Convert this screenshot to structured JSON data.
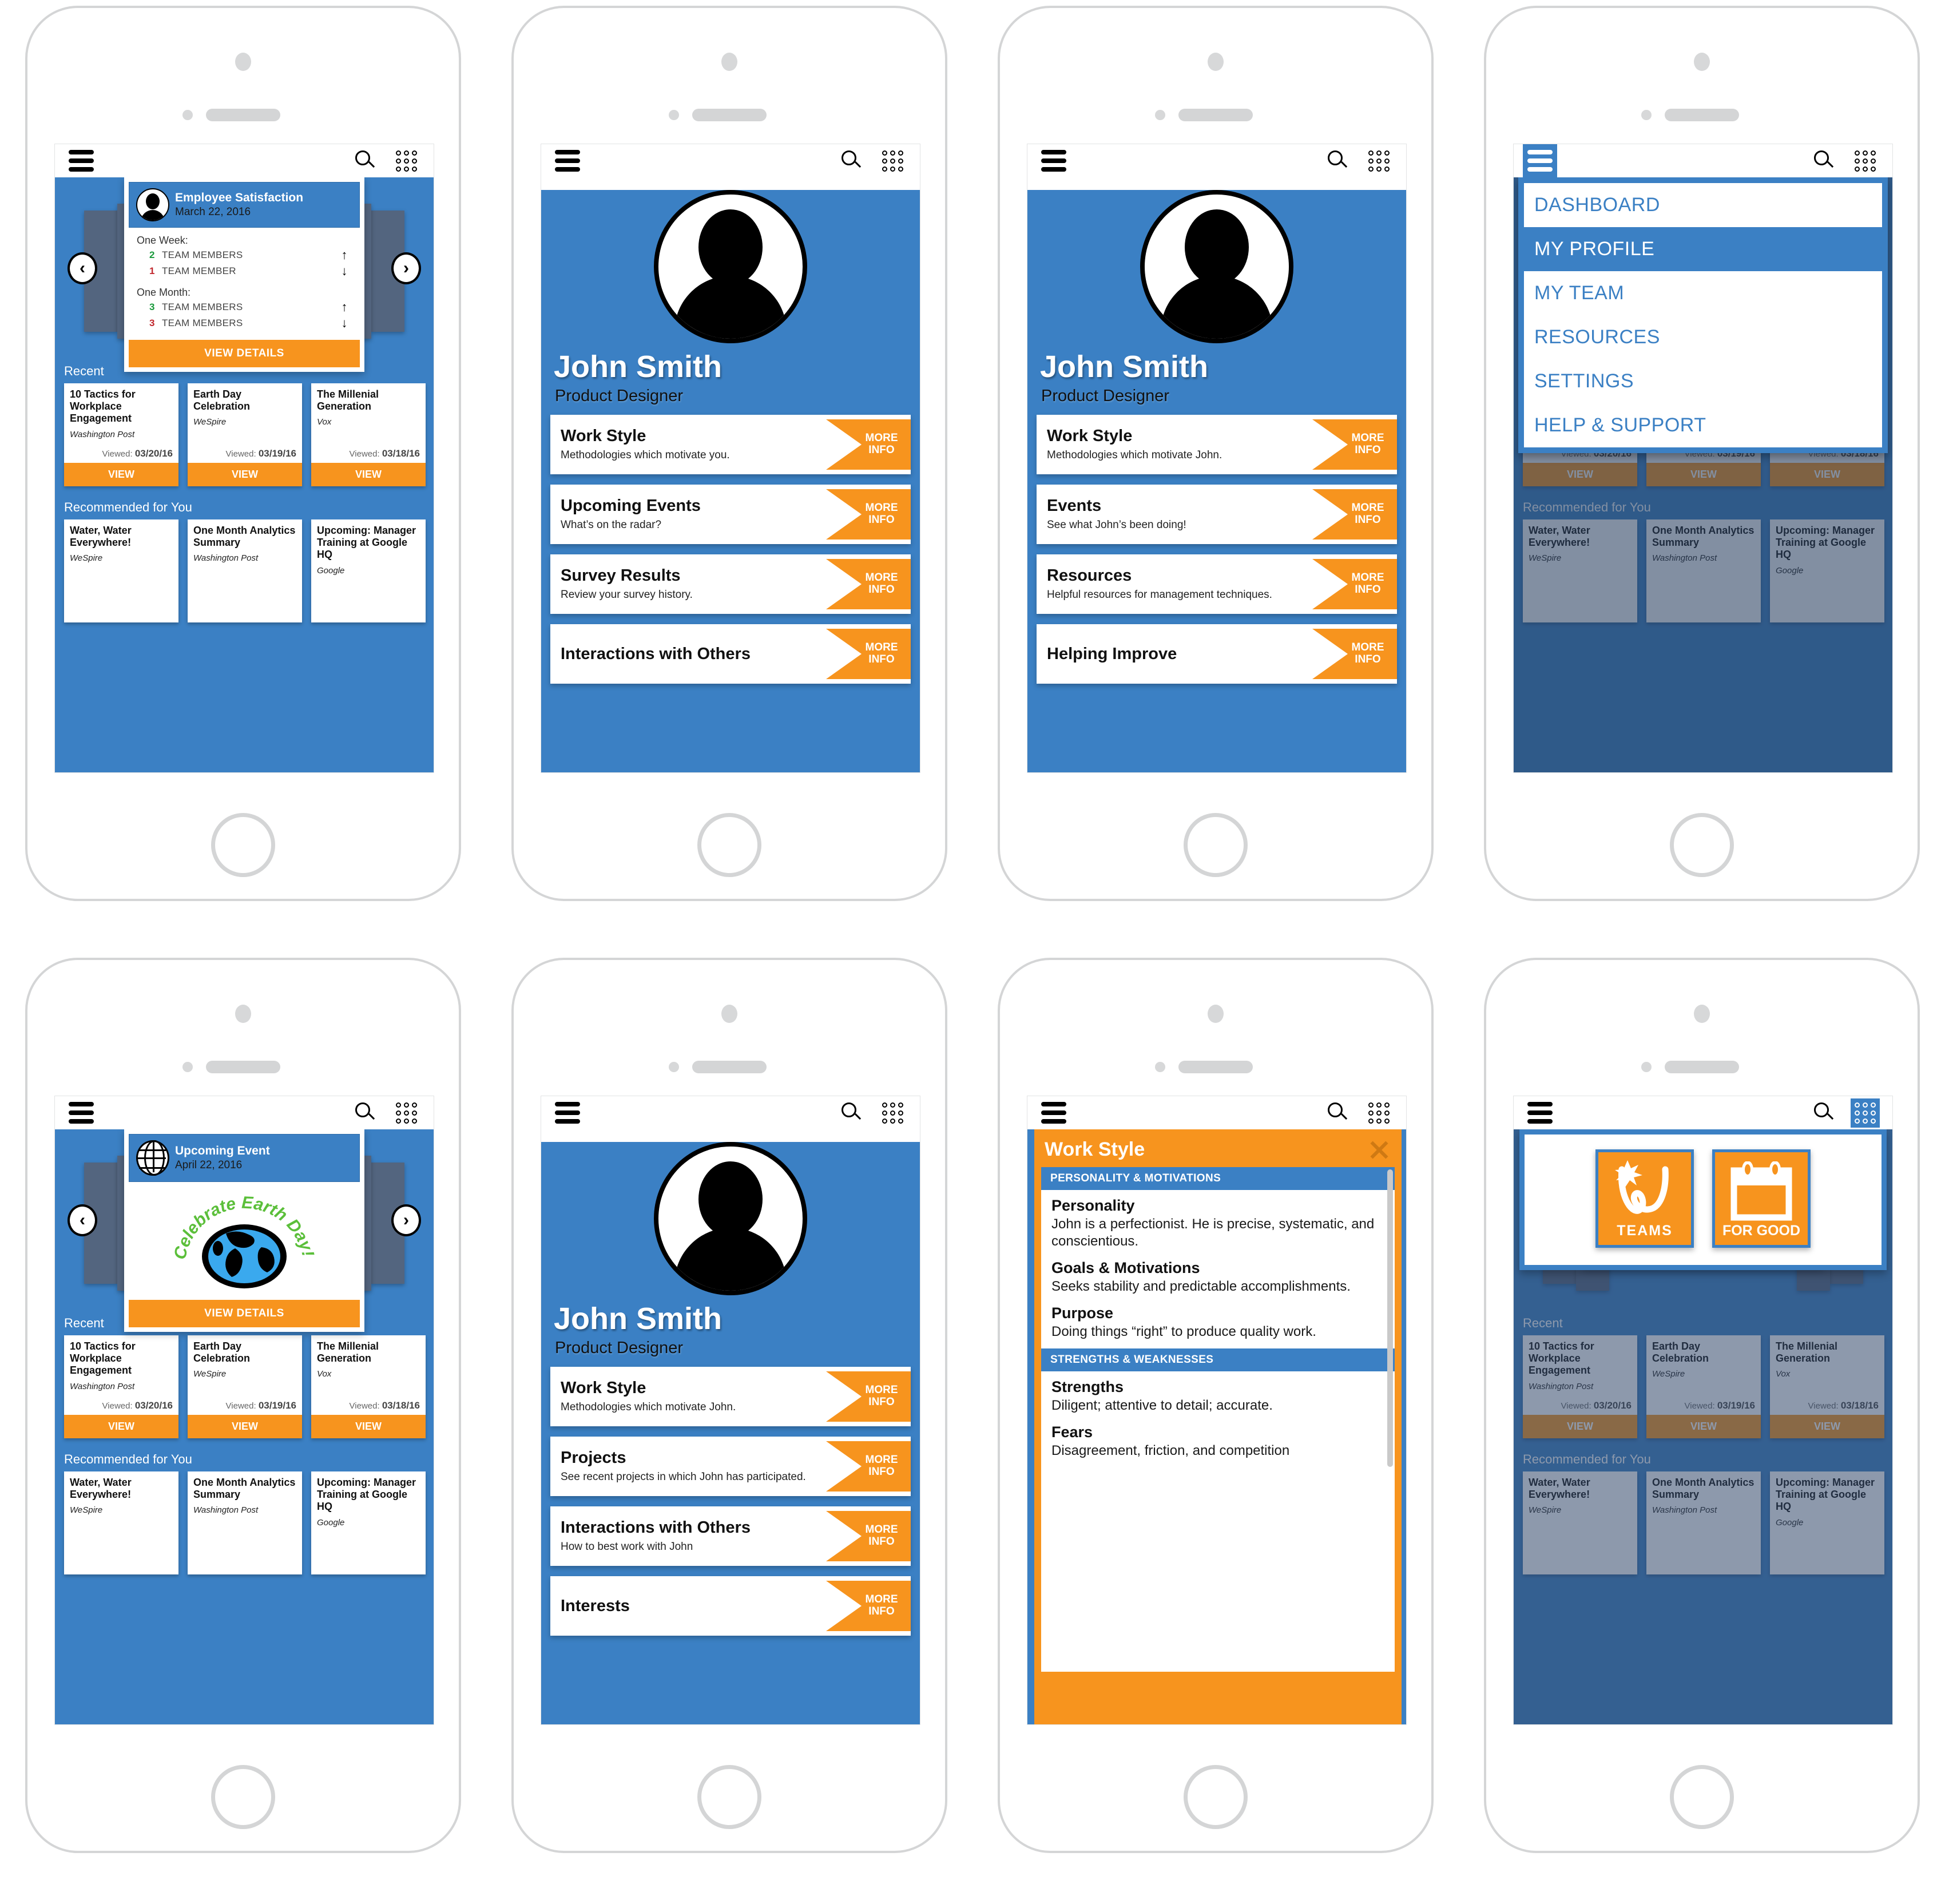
{
  "colors": {
    "blue": "#3b80c4",
    "orange": "#f7941e",
    "green": "#1a9a3c",
    "red": "#c1272d",
    "dark_slate": "#53657f"
  },
  "appbar": {
    "menu_icon": "hamburger-icon",
    "search_icon": "search-icon",
    "apps_icon": "grid-apps-icon"
  },
  "dashboard": {
    "carousel_prev": "‹",
    "carousel_next": "›",
    "satisfaction_card": {
      "avatar_icon": "person-avatar-icon",
      "title": "Employee Satisfaction",
      "date": "March 22, 2016",
      "week_label": "One Week:",
      "week_rows": [
        {
          "count": "2",
          "label": "TEAM MEMBERS",
          "arrow": "↑",
          "dir": "up"
        },
        {
          "count": "1",
          "label": "TEAM MEMBER",
          "arrow": "↓",
          "dir": "down"
        }
      ],
      "month_label": "One Month:",
      "month_rows": [
        {
          "count": "3",
          "label": "TEAM MEMBERS",
          "arrow": "↑",
          "dir": "up"
        },
        {
          "count": "3",
          "label": "TEAM MEMBERS",
          "arrow": "↓",
          "dir": "down"
        }
      ],
      "cta": "VIEW DETAILS"
    },
    "event_card": {
      "globe_icon": "globe-icon",
      "title": "Upcoming Event",
      "date": "April 22, 2016",
      "graphic_text": "Celebrate Earth Day!",
      "cta": "VIEW DETAILS"
    },
    "recent_heading": "Recent",
    "recent": [
      {
        "title": "10 Tactics for Workplace Engagement",
        "source": "Washington Post",
        "viewed_label": "Viewed:",
        "viewed": "03/20/16",
        "btn": "VIEW"
      },
      {
        "title": "Earth Day Celebration",
        "source": "WeSpire",
        "viewed_label": "Viewed:",
        "viewed": "03/19/16",
        "btn": "VIEW"
      },
      {
        "title": "The Millenial Generation",
        "source": "Vox",
        "viewed_label": "Viewed:",
        "viewed": "03/18/16",
        "btn": "VIEW"
      }
    ],
    "recommended_heading": "Recommended for You",
    "recommended": [
      {
        "title": "Water, Water Everywhere!",
        "source": "WeSpire"
      },
      {
        "title": "One Month Analytics Summary",
        "source": "Washington Post"
      },
      {
        "title": "Upcoming: Manager Training at Google HQ",
        "source": "Google"
      }
    ]
  },
  "profile": {
    "avatar_icon": "person-avatar-icon",
    "name": "John Smith",
    "role": "Product Designer",
    "more_info": "MORE INFO",
    "self_items": [
      {
        "title": "Work Style",
        "sub": "Methodologies which motivate you."
      },
      {
        "title": "Upcoming Events",
        "sub": "What’s on the radar?"
      },
      {
        "title": "Survey Results",
        "sub": "Review your survey history."
      },
      {
        "title": "Interactions with Others",
        "sub": ""
      }
    ],
    "manager_items": [
      {
        "title": "Work Style",
        "sub": "Methodologies which motivate John."
      },
      {
        "title": "Events",
        "sub": "See what John’s been doing!"
      },
      {
        "title": "Resources",
        "sub": "Helpful resources for management techniques."
      },
      {
        "title": "Helping Improve",
        "sub": ""
      }
    ],
    "team_items": [
      {
        "title": "Work Style",
        "sub": "Methodologies which motivate John."
      },
      {
        "title": "Projects",
        "sub": "See recent projects in which John has participated."
      },
      {
        "title": "Interactions with Others",
        "sub": "How to best work with John"
      },
      {
        "title": "Interests",
        "sub": ""
      }
    ]
  },
  "nav_menu": {
    "items": [
      {
        "label": "DASHBOARD",
        "active": false
      },
      {
        "label": "MY PROFILE",
        "active": true
      },
      {
        "label": "MY TEAM",
        "active": false
      },
      {
        "label": "RESOURCES",
        "active": false
      },
      {
        "label": "SETTINGS",
        "active": false
      },
      {
        "label": "HELP & SUPPORT",
        "active": false
      }
    ]
  },
  "work_style_modal": {
    "title": "Work Style",
    "close_icon": "close-icon",
    "sections": [
      {
        "group": "PERSONALITY & MOTIVATIONS",
        "fields": [
          {
            "label": "Personality",
            "text": "John is a perfectionist. He is precise, systematic, and conscientious."
          },
          {
            "label": "Goals & Motivations",
            "text": "Seeks stability and predictable accomplishments."
          },
          {
            "label": "Purpose",
            "text": "Doing things “right” to produce quality work."
          }
        ]
      },
      {
        "group": "STRENGTHS & WEAKNESSES",
        "fields": [
          {
            "label": "Strengths",
            "text": "Diligent; attentive to detail; accurate."
          },
          {
            "label": "Fears",
            "text": "Disagreement, friction, and competition"
          }
        ]
      }
    ]
  },
  "apps_menu": {
    "tiles": [
      {
        "icon": "wespire-w-icon",
        "label": "TEAMS"
      },
      {
        "icon": "calendar-icon",
        "label": "FOR GOOD"
      }
    ]
  }
}
